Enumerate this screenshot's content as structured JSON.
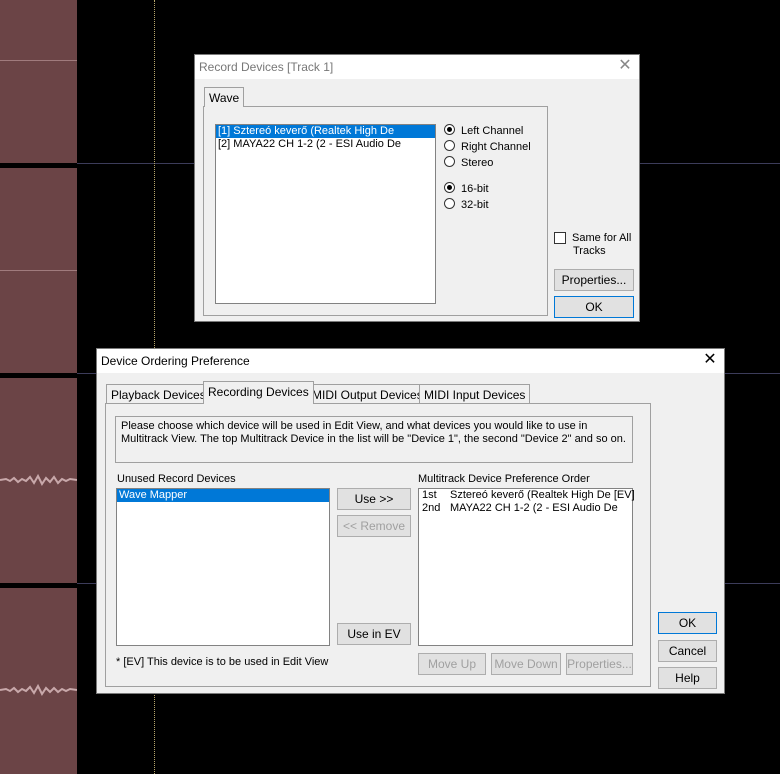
{
  "record_dialog": {
    "title": "Record Devices [Track 1]",
    "close_glyph": "✕",
    "tab_label": "Wave",
    "devices": [
      {
        "label": "[1] Sztereó keverő (Realtek High De",
        "selected": true
      },
      {
        "label": "[2] MAYA22 CH 1-2 (2 - ESI Audio De",
        "selected": false
      }
    ],
    "channels": [
      {
        "label": "Left Channel",
        "checked": true
      },
      {
        "label": "Right Channel",
        "checked": false
      },
      {
        "label": "Stereo",
        "checked": false
      }
    ],
    "bitdepths": [
      {
        "label": "16-bit",
        "checked": true
      },
      {
        "label": "32-bit",
        "checked": false
      }
    ],
    "same_for_all_label_1": "Same for All",
    "same_for_all_label_2": "Tracks",
    "same_for_all_checked": false,
    "properties_button": "Properties...",
    "ok_button": "OK"
  },
  "order_dialog": {
    "title": "Device Ordering Preference",
    "close_glyph": "✕",
    "tabs": [
      {
        "label": "Playback Devices",
        "active": false
      },
      {
        "label": "Recording Devices",
        "active": true
      },
      {
        "label": "MIDI Output Devices",
        "active": false
      },
      {
        "label": "MIDI Input Devices",
        "active": false
      }
    ],
    "info_text": "Please choose which device will be used in Edit View, and what devices you would like to use in Multitrack View.  The top Multitrack Device in the list will be \"Device 1\", the second \"Device 2\" and so on.",
    "unused_label": "Unused Record Devices",
    "unused_items": [
      {
        "label": "Wave Mapper",
        "selected": true
      }
    ],
    "use_button": "Use >>",
    "remove_button": "<< Remove",
    "use_in_ev_button": "Use in EV",
    "pref_label": "Multitrack Device Preference Order",
    "pref_items": [
      {
        "rank": "1st",
        "label": "Sztereó keverő (Realtek High De [EV]"
      },
      {
        "rank": "2nd",
        "label": "MAYA22 CH 1-2 (2 - ESI Audio De"
      }
    ],
    "footnote": "* [EV] This device is to be used in Edit View",
    "move_up_button": "Move Up",
    "move_down_button": "Move Down",
    "properties_button": "Properties...",
    "ok_button": "OK",
    "cancel_button": "Cancel",
    "help_button": "Help"
  }
}
